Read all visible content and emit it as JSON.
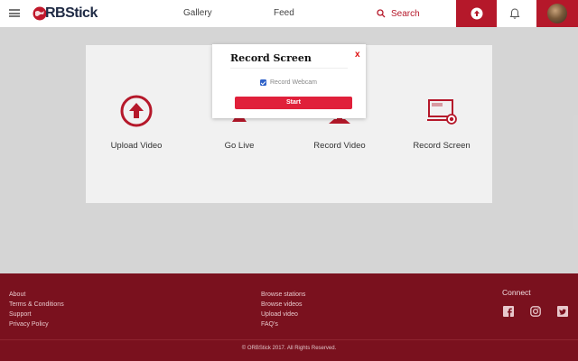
{
  "header": {
    "logo_text": "RBStick",
    "nav": [
      {
        "label": "Gallery"
      },
      {
        "label": "Feed"
      }
    ],
    "search_label": "Search"
  },
  "options": [
    {
      "label": "Upload Video",
      "icon": "upload-circle-icon"
    },
    {
      "label": "Go Live",
      "icon": "broadcast-icon"
    },
    {
      "label": "Record Video",
      "icon": "video-camera-icon"
    },
    {
      "label": "Record Screen",
      "icon": "screen-record-icon"
    }
  ],
  "modal": {
    "title": "Record Screen",
    "close": "x",
    "checkbox_label": "Record Webcam",
    "checkbox_checked": true,
    "start_label": "Start"
  },
  "footer": {
    "col1": [
      "About",
      "Terms & Conditions",
      "Support",
      "Privacy Policy"
    ],
    "col2": [
      "Browse stations",
      "Browse videos",
      "Upload video",
      "FAQ's"
    ],
    "connect_title": "Connect",
    "social": [
      "facebook-icon",
      "instagram-icon",
      "twitter-icon"
    ],
    "copyright": "© ORBStick 2017. All Rights Reserved."
  },
  "colors": {
    "brand": "#b5182a",
    "footer_bg": "#7a111e",
    "start_button": "#e0203a"
  }
}
